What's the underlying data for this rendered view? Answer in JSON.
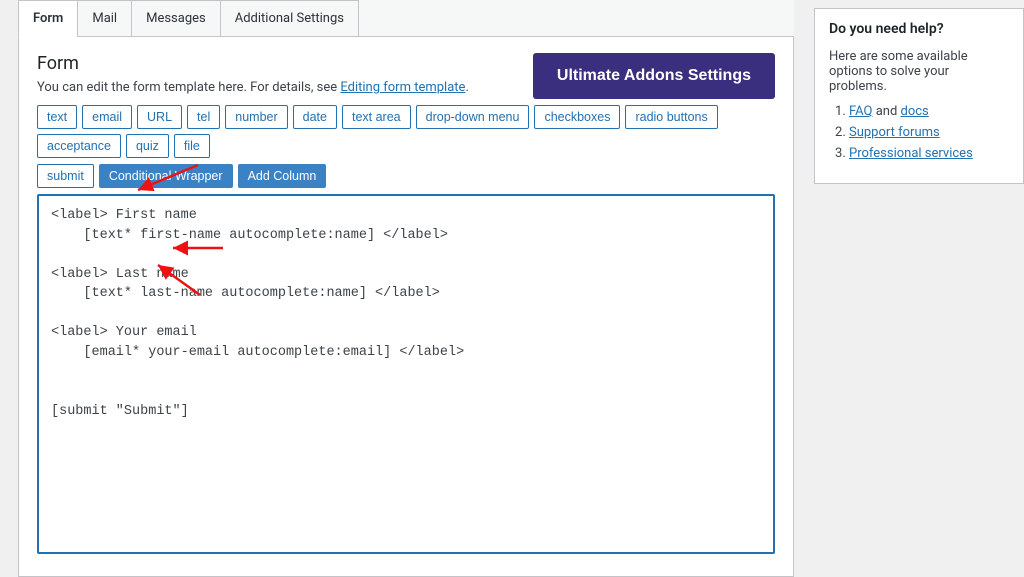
{
  "tabs": [
    "Form",
    "Mail",
    "Messages",
    "Additional Settings"
  ],
  "heading": "Form",
  "subtitle_prefix": "You can edit the form template here. For details, see ",
  "subtitle_link": "Editing form template",
  "subtitle_suffix": ".",
  "settings_button": "Ultimate Addons Settings",
  "tag_buttons_row1": [
    "text",
    "email",
    "URL",
    "tel",
    "number",
    "date",
    "text area",
    "drop-down menu",
    "checkboxes",
    "radio buttons",
    "acceptance",
    "quiz",
    "file"
  ],
  "tag_buttons_row2": [
    {
      "label": "submit",
      "style": "outline"
    },
    {
      "label": "Conditional Wrapper",
      "style": "blue"
    },
    {
      "label": "Add Column",
      "style": "blue"
    }
  ],
  "form_code": "<label> First name\n    [text* first-name autocomplete:name] </label>\n\n<label> Last name\n    [text* last-name autocomplete:name] </label>\n\n<label> Your email\n    [email* your-email autocomplete:email] </label>\n\n\n[submit \"Submit\"]",
  "help": {
    "title": "Do you need help?",
    "intro": "Here are some available options to solve your problems.",
    "items": [
      {
        "prefix": "",
        "links": [
          {
            "text": "FAQ"
          },
          {
            "text": "docs"
          }
        ],
        "between": " and "
      },
      {
        "link": "Support forums"
      },
      {
        "link": "Professional services"
      }
    ]
  }
}
